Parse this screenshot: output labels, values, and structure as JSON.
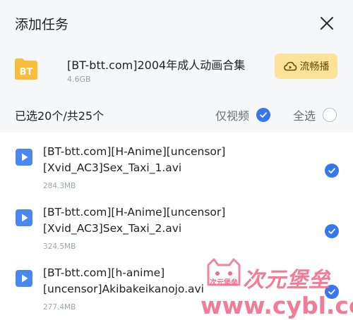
{
  "dialog": {
    "title": "添加任务"
  },
  "package": {
    "icon_text": "BT",
    "name": "[BT-btt.com]2004年成人动画合集",
    "size": "4.6GB",
    "stream_button": "流畅播"
  },
  "filter": {
    "selected_count": "已选20个/共25个",
    "only_video_label": "仅视频",
    "only_video_checked": true,
    "select_all_label": "全选",
    "select_all_checked": false
  },
  "files": [
    {
      "name": "[BT-btt.com][H-Anime][uncensor][Xvid_AC3]Sex_Taxi_1.avi",
      "size": "284.3MB",
      "checked": true
    },
    {
      "name": "[BT-btt.com][H-Anime][uncensor][Xvid_AC3]Sex_Taxi_2.avi",
      "size": "324.5MB",
      "checked": true
    },
    {
      "name": "[BT-btt.com][h-anime][uncensor]Akibakeikanojo.avi",
      "size": "277.4MB",
      "checked": true
    }
  ],
  "watermark": {
    "text_cn": "次元堡垒",
    "url": "www.cybl.cc",
    "badge": "次元堡垒"
  },
  "colors": {
    "accent": "#3677f0",
    "folder": "#f9bd3a",
    "stream_bg": "#fde29a",
    "watermark": "#f06e8a"
  }
}
